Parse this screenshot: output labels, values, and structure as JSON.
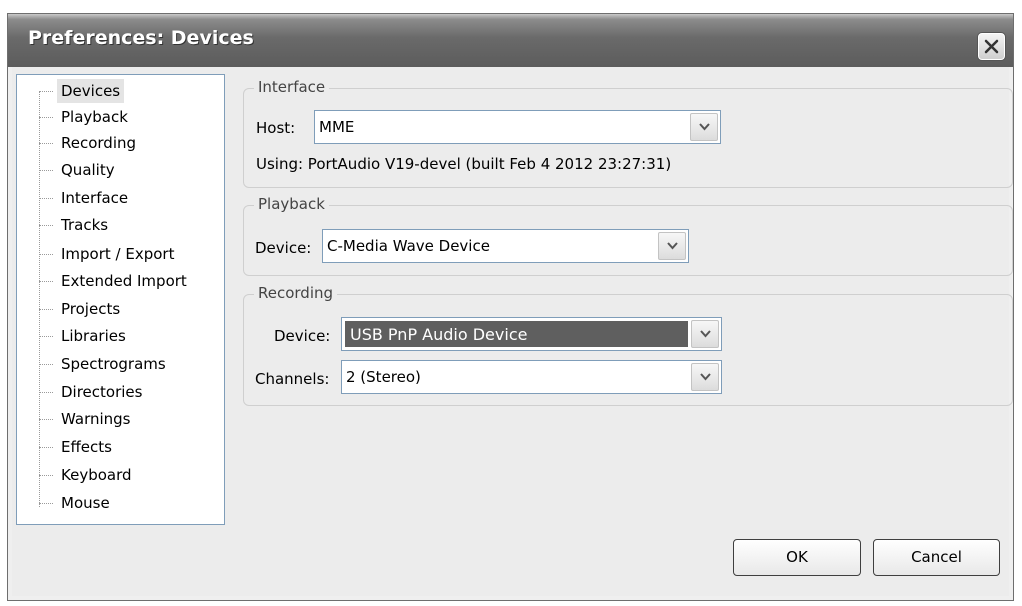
{
  "window": {
    "title": "Preferences: Devices"
  },
  "tree": {
    "items": [
      {
        "label": "Devices"
      },
      {
        "label": "Playback"
      },
      {
        "label": "Recording"
      },
      {
        "label": "Quality"
      },
      {
        "label": "Interface"
      },
      {
        "label": "Tracks"
      },
      {
        "label": "Import / Export"
      },
      {
        "label": "Extended Import"
      },
      {
        "label": "Projects"
      },
      {
        "label": "Libraries"
      },
      {
        "label": "Spectrograms"
      },
      {
        "label": "Directories"
      },
      {
        "label": "Warnings"
      },
      {
        "label": "Effects"
      },
      {
        "label": "Keyboard"
      },
      {
        "label": "Mouse"
      }
    ],
    "selected": "Devices"
  },
  "interface": {
    "legend": "Interface",
    "host_label": "Host:",
    "host_value": "MME",
    "using_text": "Using: PortAudio V19-devel (built Feb  4 2012 23:27:31)"
  },
  "playback": {
    "legend": "Playback",
    "device_label": "Device:",
    "device_value": "C-Media Wave Device"
  },
  "recording": {
    "legend": "Recording",
    "device_label": "Device:",
    "device_value": "USB PnP Audio Device",
    "channels_label": "Channels:",
    "channels_value": "2 (Stereo)"
  },
  "buttons": {
    "ok": "OK",
    "cancel": "Cancel"
  },
  "icons": {
    "close": "close-icon",
    "dropdown": "chevron-down-icon"
  }
}
